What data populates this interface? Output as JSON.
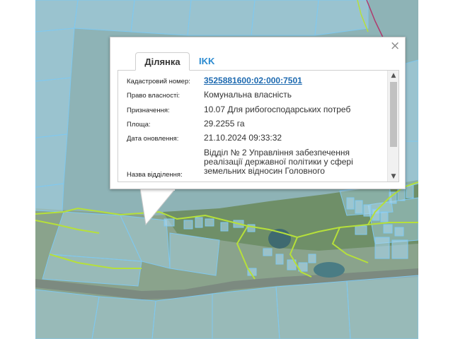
{
  "colors": {
    "parcel_fill": "#a8d6ee",
    "parcel_border": "#7fc8ef",
    "boundary_green": "#b6e03a",
    "link_blue": "#1e6ab0",
    "tab_blue": "#2a8ad0",
    "road_line": "#b03a6e"
  },
  "popup": {
    "close_symbol": "×",
    "tabs": {
      "active": "Ділянка",
      "inactive": "IKK"
    },
    "fields": {
      "cadastral_label": "Кадастровий номер:",
      "cadastral_value": "3525881600:02:000:7501",
      "ownership_label": "Право власності:",
      "ownership_value": "Комунальна власність",
      "purpose_label": "Призначення:",
      "purpose_value": "10.07 Для рибогосподарських потреб",
      "area_label": "Площа:",
      "area_value": "29.2255 га",
      "updated_label": "Дата оновлення:",
      "updated_value": "21.10.2024 09:33:32",
      "department_label": "Назва відділення:",
      "department_value": "Відділ № 2 Управління забезпечення реалізації державної політики у сфері земельних відносин Головного"
    },
    "scroll_up": "▲",
    "scroll_down": "▼"
  }
}
